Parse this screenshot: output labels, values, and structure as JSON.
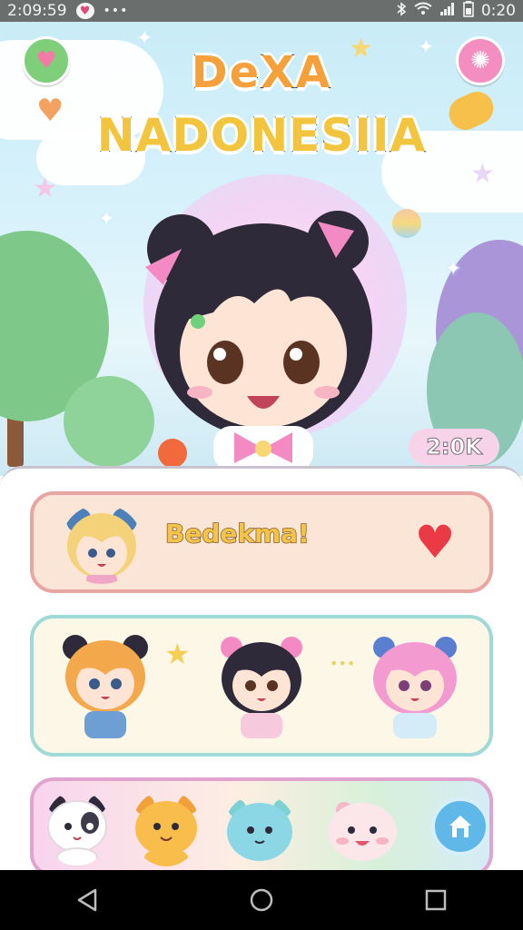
{
  "status_bar": {
    "time": "2:09:59",
    "dots": "•••",
    "battery_time": "0:20",
    "icons": [
      "heart-icon",
      "bluetooth-icon",
      "wifi-icon",
      "signal-icon",
      "battery-icon"
    ]
  },
  "game": {
    "title_line1": "DeXA",
    "title_line2": "NADONESIIA",
    "counter": "2:0K"
  },
  "cards": {
    "greeting": {
      "text": "Bedekma!"
    }
  },
  "colors": {
    "status_bar": "#6a6f6e",
    "sky": "#c9ecf7",
    "card_greeting_bg": "#fbe5d6",
    "card_greeting_border": "#e8a6a2",
    "card_characters_border": "#9fd9d8",
    "card_pets_border": "#e0a4cf",
    "heart": "#e93a46",
    "home_button": "#5fb8e8"
  },
  "nav": {
    "icons": [
      "back-icon",
      "home-circle-icon",
      "recents-icon"
    ]
  }
}
